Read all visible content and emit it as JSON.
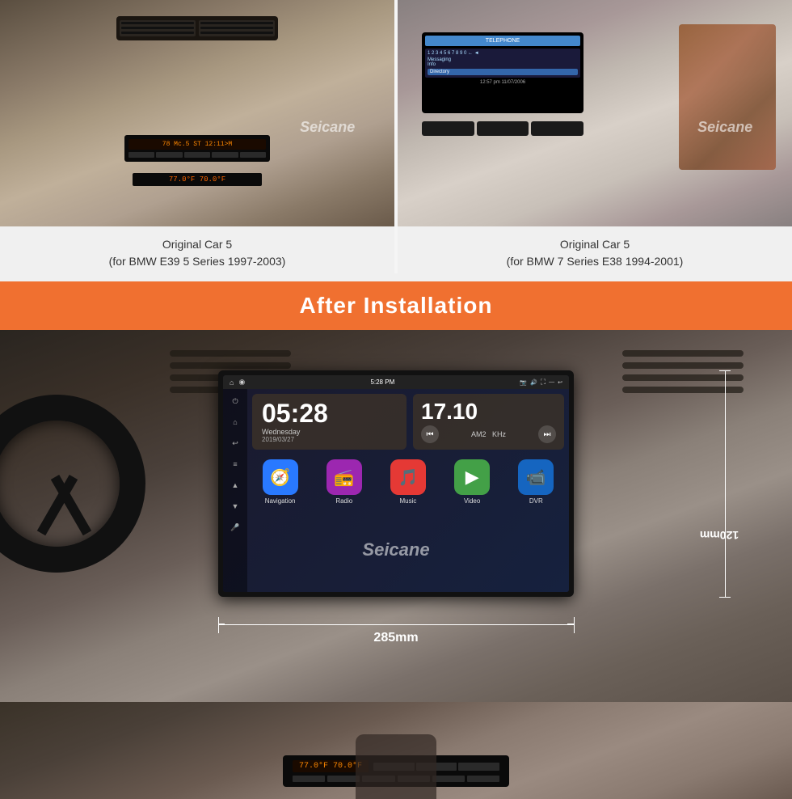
{
  "brand": "Seicane",
  "topSection": {
    "car1": {
      "caption_line1": "Original Car 5",
      "caption_line2": "(for BMW E39 5 Series 1997-2003)",
      "radio_display": "78 Mc.5 ST    12:11>M",
      "temp_display": "77.0°F  70.0°F"
    },
    "car2": {
      "caption_line1": "Original Car 5",
      "caption_line2": "(for BMW 7 Series E38 1994-2001)"
    }
  },
  "banner": {
    "text": "After Installation"
  },
  "afterInstallation": {
    "screen": {
      "statusBar": {
        "home_icon": "⌂",
        "location_icon": "◉",
        "time": "5:28 PM",
        "camera_icon": "📷",
        "volume_icon": "🔊",
        "fullscreen_icon": "⛶",
        "minimize_icon": "—",
        "back_icon": "↩"
      },
      "clock": {
        "time": "05:28",
        "day": "Wednesday",
        "date": "2019/03/27"
      },
      "radio": {
        "frequency": "17.10",
        "band": "AM2",
        "unit": "KHz"
      },
      "apps": [
        {
          "label": "Navigation",
          "icon": "🧭",
          "color": "#2979ff"
        },
        {
          "label": "Radio",
          "icon": "📻",
          "color": "#9c27b0"
        },
        {
          "label": "Music",
          "icon": "🎵",
          "color": "#e53935"
        },
        {
          "label": "Video",
          "icon": "▶",
          "color": "#43a047"
        },
        {
          "label": "DVR",
          "icon": "📹",
          "color": "#1565c0"
        }
      ]
    },
    "dimensions": {
      "width": "285mm",
      "height": "120mm"
    }
  },
  "bottomSection": {
    "radio_display": "77.0°F  70.0°F"
  }
}
